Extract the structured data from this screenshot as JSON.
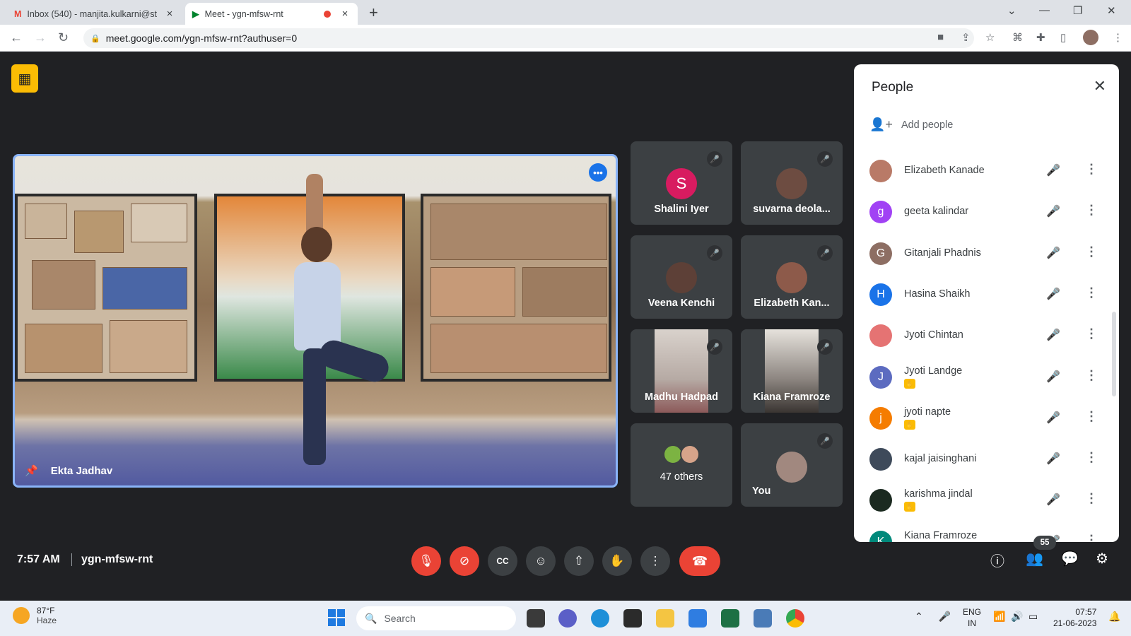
{
  "browser": {
    "tabs": [
      {
        "title": "Inbox (540) - manjita.kulkarni@st",
        "icon": "gmail-icon",
        "active": false
      },
      {
        "title": "Meet - ygn-mfsw-rnt",
        "icon": "meet-icon",
        "active": true
      }
    ],
    "url": "meet.google.com/ygn-mfsw-rnt?authuser=0"
  },
  "meeting": {
    "pinned": {
      "name": "Ekta Jadhav"
    },
    "tiles": [
      {
        "name": "Shalini Iyer",
        "initial": "S",
        "color": "#d81b60"
      },
      {
        "name": "suvarna deola..."
      },
      {
        "name": "Veena Kenchi"
      },
      {
        "name": "Elizabeth Kan..."
      },
      {
        "name": "Madhu Hadpad"
      },
      {
        "name": "Kiana Framroze"
      },
      {
        "name": "47 others"
      },
      {
        "name": "You"
      }
    ],
    "time": "7:57 AM",
    "code": "ygn-mfsw-rnt",
    "participant_count": "55"
  },
  "people_panel": {
    "title": "People",
    "add_people": "Add people",
    "list": [
      {
        "name": "Elizabeth Kanade",
        "initial": "",
        "color": "#b97a67",
        "hand": false
      },
      {
        "name": "geeta kalindar",
        "initial": "g",
        "color": "#a142f4",
        "hand": false
      },
      {
        "name": "Gitanjali Phadnis",
        "initial": "G",
        "color": "#8d6e63",
        "hand": false
      },
      {
        "name": "Hasina Shaikh",
        "initial": "H",
        "color": "#1a73e8",
        "hand": false
      },
      {
        "name": "Jyoti Chintan",
        "initial": "",
        "color": "#e57373",
        "hand": false
      },
      {
        "name": "Jyoti Landge",
        "initial": "J",
        "color": "#5c6bc0",
        "hand": true
      },
      {
        "name": "jyoti napte",
        "initial": "j",
        "color": "#f57c00",
        "hand": true
      },
      {
        "name": "kajal jaisinghani",
        "initial": "",
        "color": "#3e4a5a",
        "hand": false
      },
      {
        "name": "karishma jindal",
        "initial": "",
        "color": "#1b2a20",
        "hand": true
      },
      {
        "name": "Kiana Framroze",
        "initial": "K",
        "color": "#00897b",
        "hand": true
      }
    ]
  },
  "taskbar": {
    "weather_temp": "87°F",
    "weather_desc": "Haze",
    "search": "Search",
    "lang1": "ENG",
    "lang2": "IN",
    "time": "07:57",
    "date": "21-06-2023"
  }
}
